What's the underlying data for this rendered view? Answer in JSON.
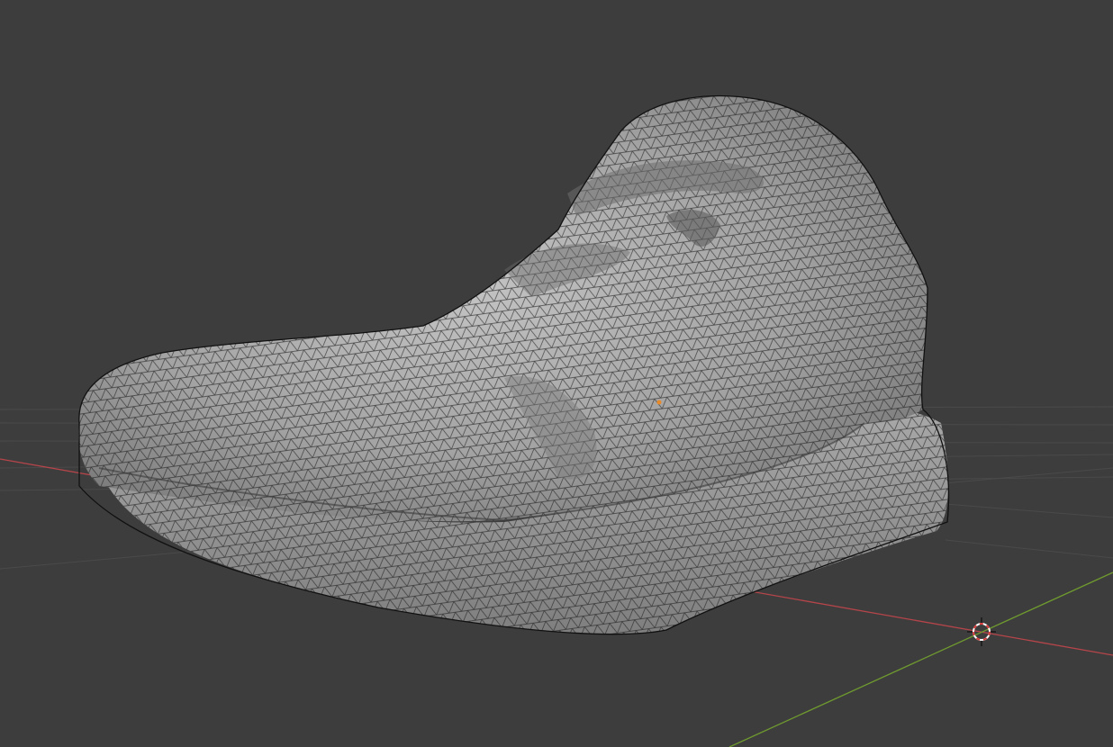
{
  "viewport": {
    "background_color": "#3d3d3d",
    "grid_line_color": "#4a4a4a",
    "x_axis_color": "#b5454a",
    "y_axis_color": "#6f9a2f",
    "mesh_fill_color": "#8f8f8f",
    "mesh_highlight_color": "#bdbdbd",
    "wireframe_color": "#1c1c1c",
    "origin_marker_color": "#e88a2a",
    "cursor_colors": [
      "#d83a3a",
      "#ffffff",
      "#222222"
    ]
  },
  "scene": {
    "object_shading": "solid-with-wireframe",
    "object_origin_icon": "object-origin-dot",
    "cursor_icon": "3d-cursor-icon"
  }
}
